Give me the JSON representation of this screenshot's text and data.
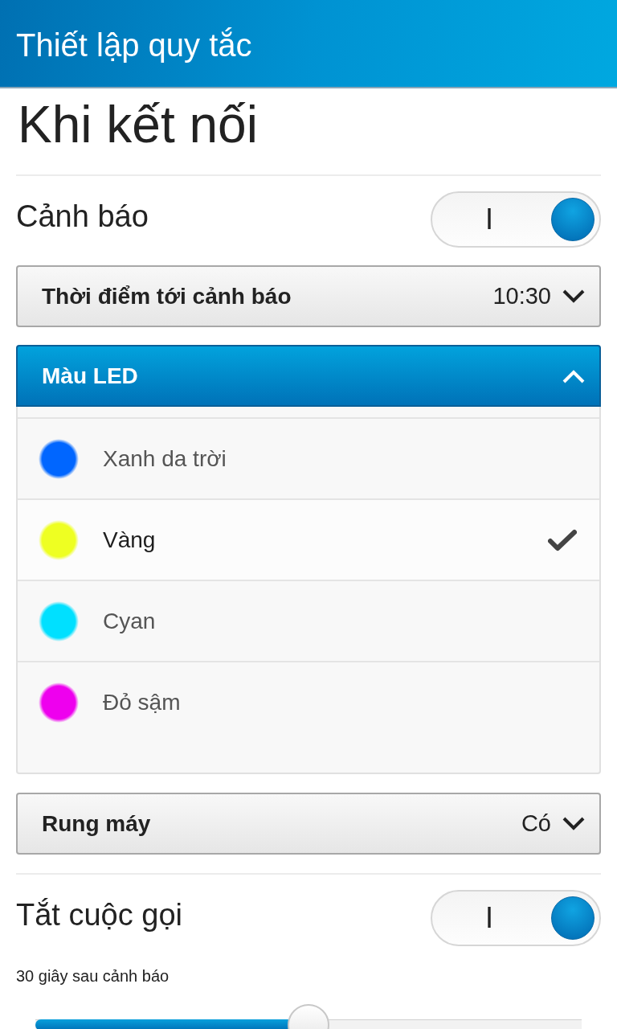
{
  "header": {
    "title": "Thiết lập quy tắc"
  },
  "page_title": "Khi kết nối",
  "settings": [
    {
      "kind": "toggle",
      "label": "Cảnh báo",
      "on": true,
      "on_label": "I"
    },
    {
      "kind": "dropdown",
      "label": "Thời điểm tới cảnh báo",
      "value": "10:30",
      "expanded": false
    },
    {
      "kind": "dropdown",
      "label": "Màu LED",
      "expanded": true,
      "options": [
        {
          "label": "Xanh da trời",
          "color": "#0066ff",
          "selected": false
        },
        {
          "label": "Vàng",
          "color": "#eeff22",
          "selected": true
        },
        {
          "label": "Cyan",
          "color": "#00e0ff",
          "selected": false
        },
        {
          "label": "Đỏ sậm",
          "color": "#ee00ee",
          "selected": false
        }
      ]
    },
    {
      "kind": "dropdown",
      "label": "Rung máy",
      "value": "Có",
      "expanded": false
    },
    {
      "kind": "toggle",
      "label": "Tắt cuộc gọi",
      "on": true,
      "on_label": "I"
    },
    {
      "kind": "slider",
      "label": "30 giây sau cảnh báo",
      "level": 0.5
    }
  ]
}
